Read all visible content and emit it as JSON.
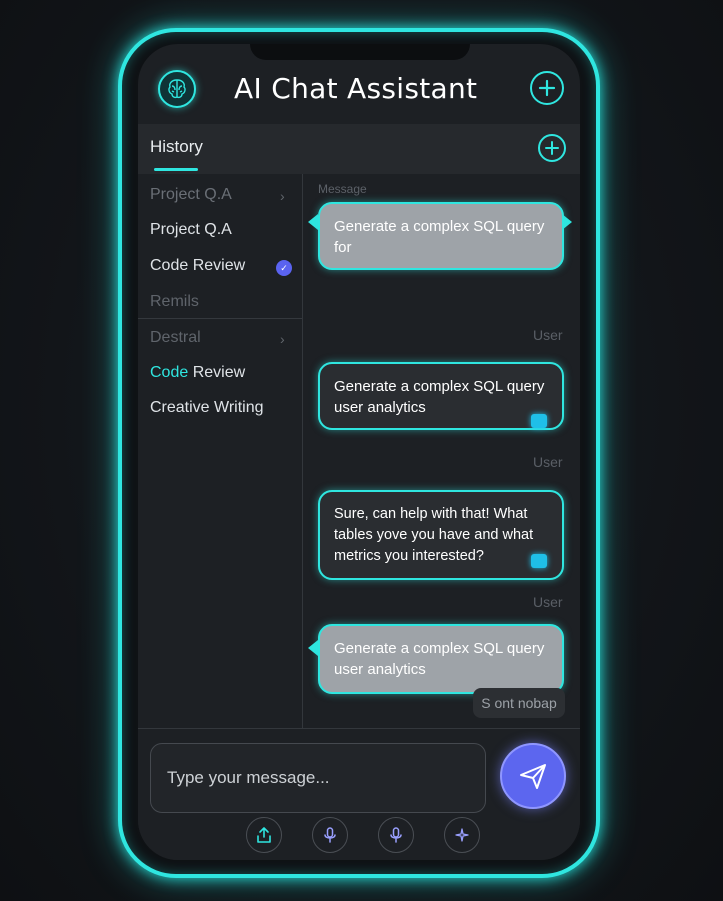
{
  "app": {
    "title": "AI Chat Assistant",
    "logo_icon": "brain-icon",
    "add_icon": "plus-icon"
  },
  "history": {
    "label": "History",
    "add_icon": "plus-icon"
  },
  "sidebar": {
    "items": [
      {
        "label": "Project Q.A",
        "state": "dim",
        "chevron": true
      },
      {
        "label": "Project Q.A",
        "state": "normal"
      },
      {
        "label": "Code Review",
        "state": "normal",
        "badge": true
      },
      {
        "label": "Remils",
        "state": "dim"
      },
      {
        "label": "Destral",
        "state": "dim",
        "chevron": true
      },
      {
        "label_accent": "Code",
        "label_rest": " Review",
        "state": "accent"
      },
      {
        "label": "Creative Writing",
        "state": "normal"
      }
    ]
  },
  "chat": {
    "header_label": "Message",
    "messages": [
      {
        "text": "Generate a complex SQL query for",
        "style": "user"
      },
      {
        "role": "User"
      },
      {
        "text": "Generate a complex SQL query user analytics",
        "style": "dark"
      },
      {
        "role": "User"
      },
      {
        "text": "Sure, can help with that! What tables yove you have and what metrics you interested?",
        "style": "dark"
      },
      {
        "role": "User"
      },
      {
        "text": "Generate a complex SQL query user analytics",
        "style": "user"
      }
    ],
    "chip_label": "S ont nobap"
  },
  "composer": {
    "placeholder": "Type your message...",
    "send_icon": "send-icon",
    "tools": [
      "upload-icon",
      "microphone-icon",
      "microphone-icon",
      "sparkle-icon"
    ]
  },
  "colors": {
    "accent": "#2fe6e0",
    "send": "#5c66ef",
    "background": "#1d2024"
  }
}
